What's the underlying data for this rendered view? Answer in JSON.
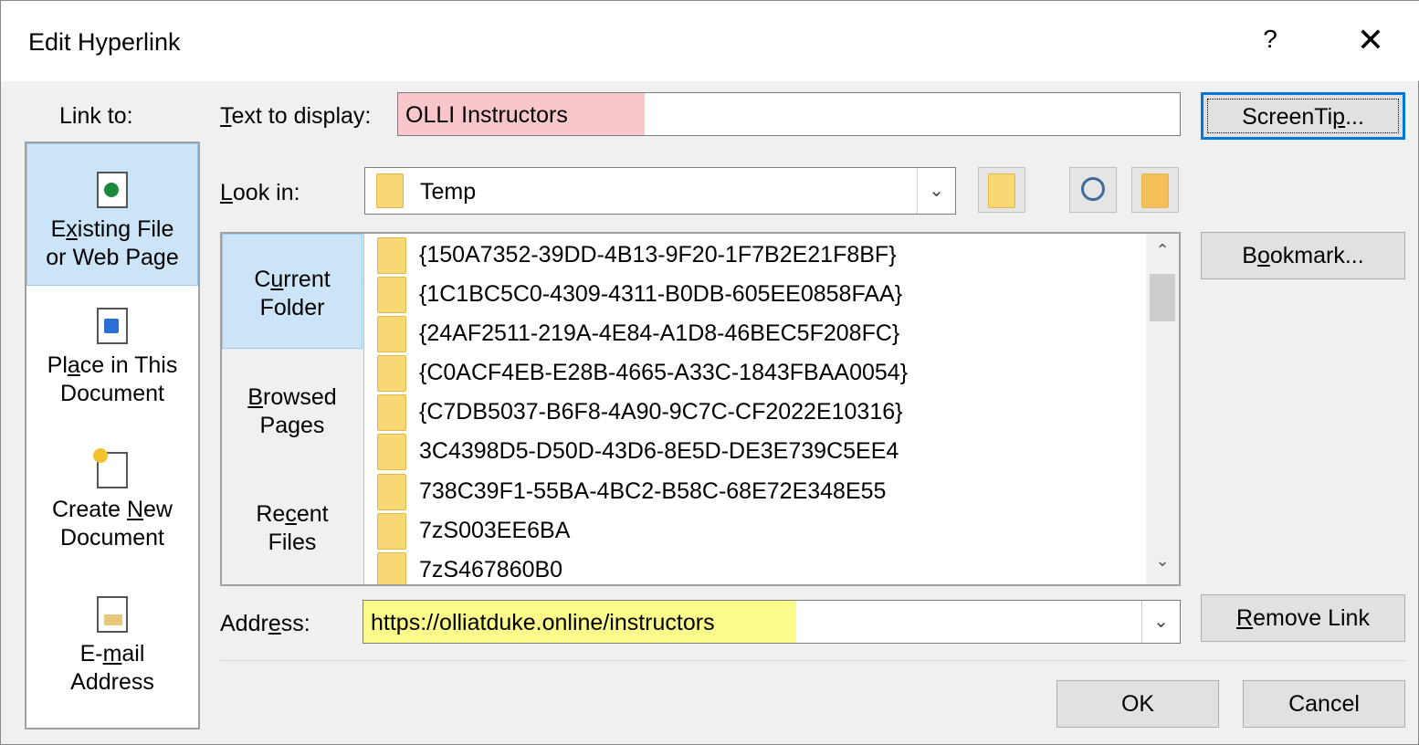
{
  "window": {
    "title": "Edit Hyperlink",
    "help_glyph": "?",
    "close_glyph": "✕"
  },
  "link_to": {
    "label": "Link to:",
    "items": [
      {
        "line1": "Existing File",
        "line2": "or Web Page",
        "icon": "existing-file-icon",
        "selected": true
      },
      {
        "line1": "Place in This",
        "line2": "Document",
        "icon": "place-in-document-icon",
        "selected": false
      },
      {
        "line1": "Create New",
        "line2": "Document",
        "icon": "new-document-icon",
        "selected": false
      },
      {
        "line1": "E-mail",
        "line2": "Address",
        "icon": "email-icon",
        "selected": false
      }
    ]
  },
  "text_to_display": {
    "label": "Text to display:",
    "value": "OLLI Instructors"
  },
  "screentip_button": "ScreenTip...",
  "look_in": {
    "label": "Look in:",
    "value": "Temp"
  },
  "side_tabs": [
    {
      "line1": "Current",
      "line2": "Folder",
      "selected": true
    },
    {
      "line1": "Browsed",
      "line2": "Pages",
      "selected": false
    },
    {
      "line1": "Recent",
      "line2": "Files",
      "selected": false
    }
  ],
  "files": [
    "{150A7352-39DD-4B13-9F20-1F7B2E21F8BF}",
    "{1C1BC5C0-4309-4311-B0DB-605EE0858FAA}",
    "{24AF2511-219A-4E84-A1D8-46BEC5F208FC}",
    "{C0ACF4EB-E28B-4665-A33C-1843FBAA0054}",
    "{C7DB5037-B6F8-4A90-9C7C-CF2022E10316}",
    "3C4398D5-D50D-43D6-8E5D-DE3E739C5EE4",
    "738C39F1-55BA-4BC2-B58C-68E72E348E55",
    "7zS003EE6BA",
    "7zS467860B0"
  ],
  "bookmark_button": "Bookmark...",
  "address": {
    "label": "Address:",
    "value": "https://olliatduke.online/instructors"
  },
  "remove_link_button": "Remove Link",
  "ok_button": "OK",
  "cancel_button": "Cancel"
}
